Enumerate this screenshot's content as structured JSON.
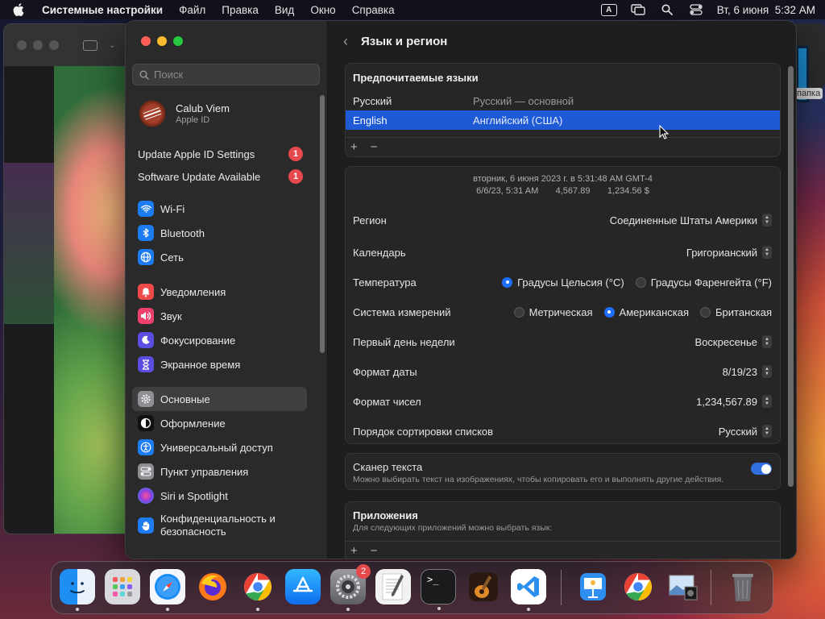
{
  "menubar": {
    "app_name": "Системные настройки",
    "menus": [
      "Файл",
      "Правка",
      "Вид",
      "Окно",
      "Справка"
    ],
    "input_source": "A",
    "datetime": "Вт, 6 июня  5:32 AM"
  },
  "desktop": {
    "folder_label": "папка"
  },
  "sidebar": {
    "search_placeholder": "Поиск",
    "user_name": "Calub Viem",
    "user_sub": "Apple ID",
    "alerts": [
      {
        "label": "Update Apple ID Settings",
        "badge": "1"
      },
      {
        "label": "Software Update Available",
        "badge": "1"
      }
    ],
    "group1": [
      {
        "label": "Wi-Fi",
        "icon": "wifi-icon",
        "color": "#1e7cf2"
      },
      {
        "label": "Bluetooth",
        "icon": "bluetooth-icon",
        "color": "#1e7cf2"
      },
      {
        "label": "Сеть",
        "icon": "globe-icon",
        "color": "#1e7cf2"
      }
    ],
    "group2": [
      {
        "label": "Уведомления",
        "icon": "bell-icon",
        "color": "#ef4a4a"
      },
      {
        "label": "Звук",
        "icon": "speaker-icon",
        "color": "#ef3f6b"
      },
      {
        "label": "Фокусирование",
        "icon": "moon-icon",
        "color": "#5b4de0"
      },
      {
        "label": "Экранное время",
        "icon": "hourglass-icon",
        "color": "#5b4de0"
      }
    ],
    "group3": [
      {
        "label": "Основные",
        "icon": "gear-icon",
        "color": "#8e8e93",
        "active": true
      },
      {
        "label": "Оформление",
        "icon": "appearance-icon",
        "color": "#111111"
      },
      {
        "label": "Универсальный доступ",
        "icon": "accessibility-icon",
        "color": "#1e7cf2"
      },
      {
        "label": "Пункт управления",
        "icon": "control-center-icon",
        "color": "#8e8e93"
      },
      {
        "label": "Siri и Spotlight",
        "icon": "siri-icon",
        "color": "#b44bd6"
      },
      {
        "label": "Конфиденциальность и безопасность",
        "icon": "hand-icon",
        "color": "#1e7cf2"
      }
    ]
  },
  "content": {
    "title": "Язык и регион",
    "preferred_title": "Предпочитаемые языки",
    "languages": [
      {
        "name": "Русский",
        "detail": "Русский — основной",
        "selected": false
      },
      {
        "name": "English",
        "detail": "Английский (США)",
        "selected": true
      }
    ],
    "add_btn": "+",
    "remove_btn": "−",
    "preview_line1": "вторник, 6 июня 2023 г. в 5:31:48 AM GMT-4",
    "preview_line2": "6/6/23, 5:31 AM       4,567.89       1,234.56 $",
    "region_label": "Регион",
    "region_value": "Соединенные Штаты Америки",
    "calendar_label": "Календарь",
    "calendar_value": "Григорианский",
    "temperature_label": "Температура",
    "temp_celsius": "Градусы Цельсия (°C)",
    "temp_fahrenheit": "Градусы Фаренгейта (°F)",
    "measure_label": "Система измерений",
    "measure_metric": "Метрическая",
    "measure_us": "Американская",
    "measure_uk": "Британская",
    "first_day_label": "Первый день недели",
    "first_day_value": "Воскресенье",
    "date_format_label": "Формат даты",
    "date_format_value": "8/19/23",
    "number_format_label": "Формат чисел",
    "number_format_value": "1,234,567.89",
    "sort_label": "Порядок сортировки списков",
    "sort_value": "Русский",
    "live_text_title": "Сканер текста",
    "live_text_desc": "Можно выбирать текст на изображениях, чтобы копировать его и выполнять другие действия.",
    "apps_title": "Приложения",
    "apps_desc": "Для следующих приложений можно выбрать язык:"
  },
  "dock": {
    "settings_badge": "2"
  }
}
